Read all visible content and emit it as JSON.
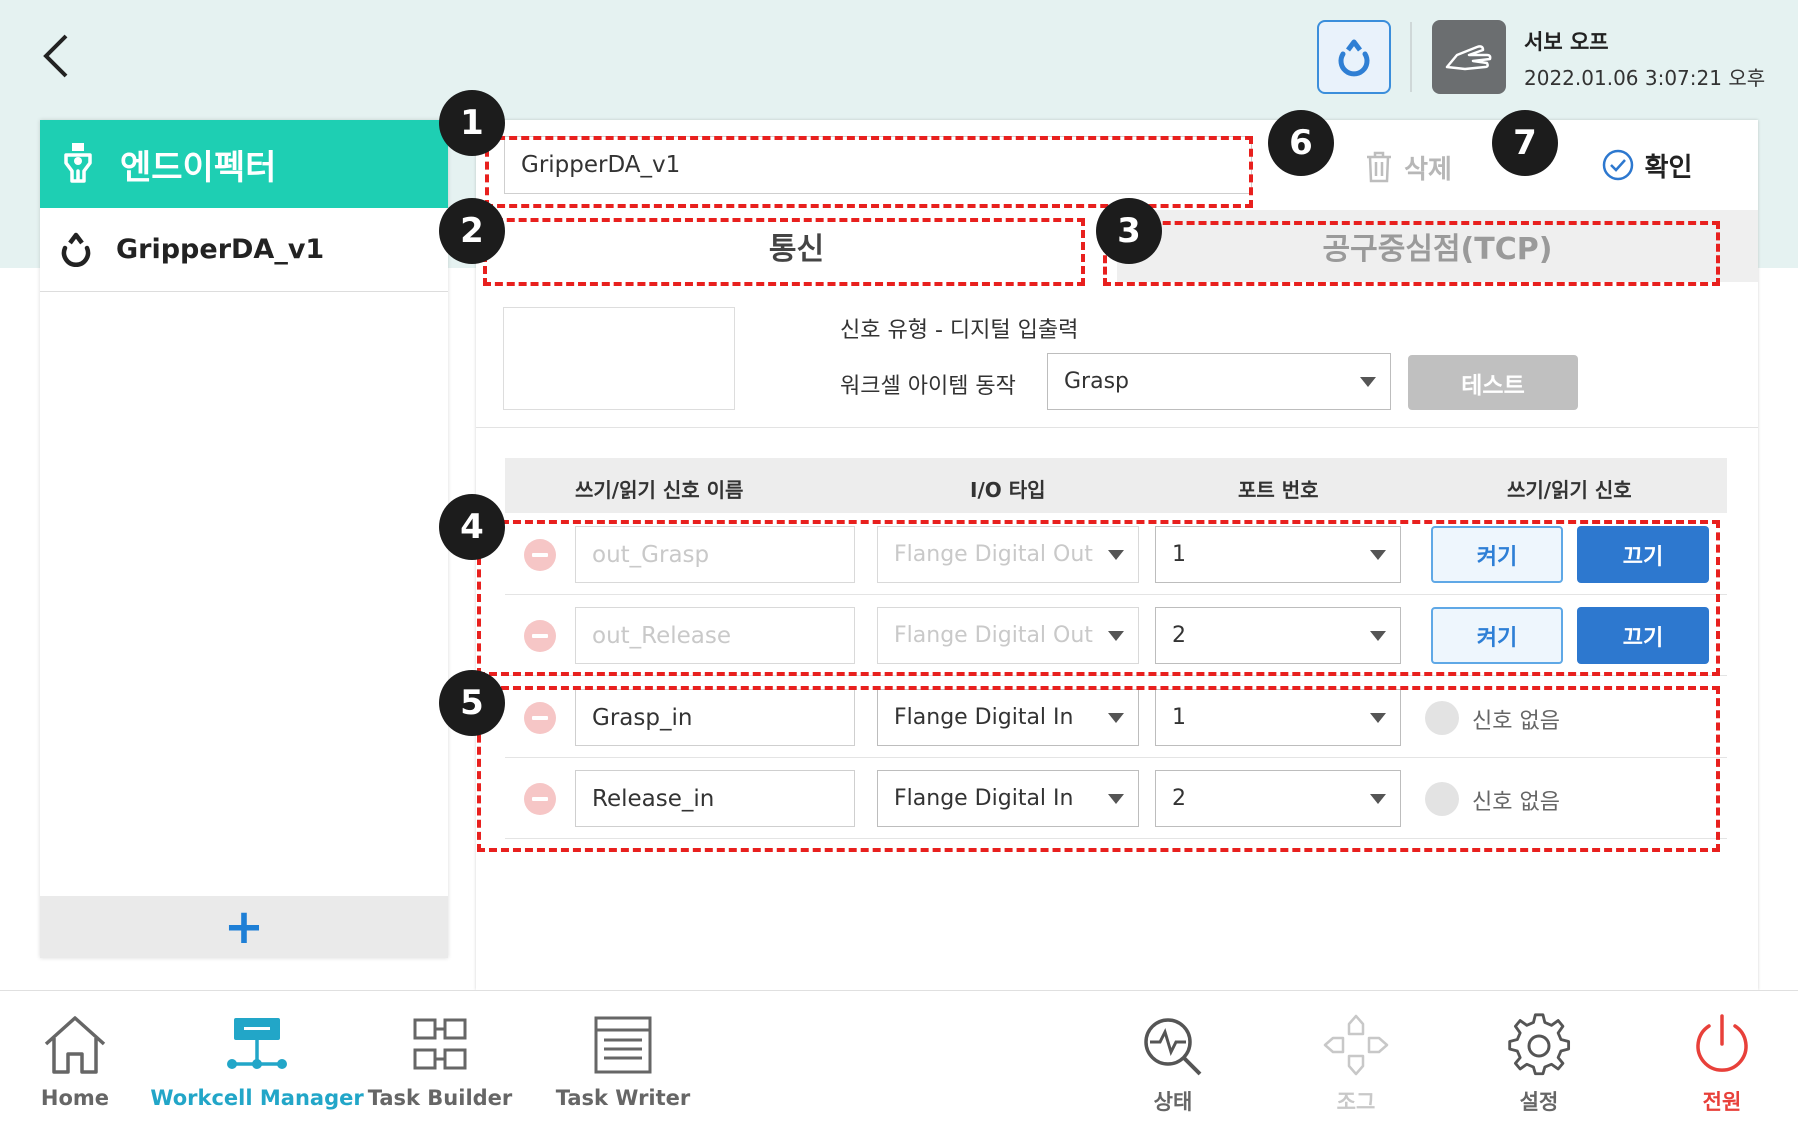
{
  "header": {
    "servo_status": "서보 오프",
    "datetime": "2022.01.06 3:07:21 오후",
    "accent_color": "#3b8edb"
  },
  "sidebar": {
    "title": "엔드이펙터",
    "items": [
      {
        "label": "GripperDA_v1"
      }
    ],
    "add_label": "+"
  },
  "editor": {
    "name_value": "GripperDA_v1",
    "delete_label": "삭제",
    "confirm_label": "확인"
  },
  "tabs": [
    {
      "label": "통신",
      "active": true
    },
    {
      "label": "공구중심점(TCP)",
      "active": false
    }
  ],
  "comm": {
    "signal_type": "신호 유형 - 디지털 입출력",
    "action_label": "워크셀 아이템 동작",
    "action_value": "Grasp",
    "test_label": "테스트"
  },
  "table": {
    "headers": [
      "쓰기/읽기 신호 이름",
      "I/O 타입",
      "포트 번호",
      "쓰기/읽기 신호"
    ],
    "output_rows": [
      {
        "name": "out_Grasp",
        "io_type": "Flange Digital Out",
        "port": "1",
        "on_label": "켜기",
        "off_label": "끄기"
      },
      {
        "name": "out_Release",
        "io_type": "Flange Digital Out",
        "port": "2",
        "on_label": "켜기",
        "off_label": "끄기"
      }
    ],
    "input_rows": [
      {
        "name": "Grasp_in",
        "io_type": "Flange Digital In",
        "port": "1",
        "signal": "신호 없음"
      },
      {
        "name": "Release_in",
        "io_type": "Flange Digital In",
        "port": "2",
        "signal": "신호 없음"
      }
    ]
  },
  "badges": [
    "1",
    "2",
    "3",
    "4",
    "5",
    "6",
    "7"
  ],
  "nav": {
    "left": [
      {
        "label": "Home",
        "icon": "home-icon",
        "active": false
      },
      {
        "label": "Workcell Manager",
        "icon": "workcell-icon",
        "active": true
      },
      {
        "label": "Task Builder",
        "icon": "task-builder-icon",
        "active": false
      },
      {
        "label": "Task Writer",
        "icon": "task-writer-icon",
        "active": false
      }
    ],
    "right": [
      {
        "label": "상태",
        "icon": "status-icon"
      },
      {
        "label": "조그",
        "icon": "jog-icon",
        "disabled": true
      },
      {
        "label": "설정",
        "icon": "settings-icon"
      },
      {
        "label": "전원",
        "icon": "power-icon",
        "color": "#e8403a"
      }
    ]
  }
}
